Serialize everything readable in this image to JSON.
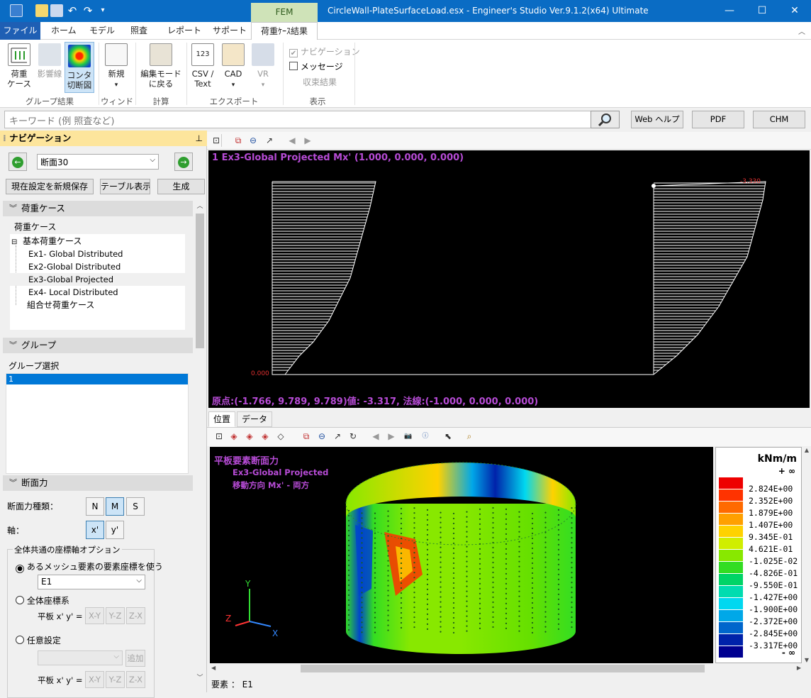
{
  "window": {
    "title": "CircleWall-PlateSurfaceLoad.esx - Engineer's Studio Ver.9.1.2(x64) Ultimate",
    "context_tab": "FEM",
    "controls": [
      "—",
      "☐",
      "✕"
    ]
  },
  "ribbon_tabs": [
    "ファイル",
    "ホーム",
    "モデル",
    "照査",
    "レポート",
    "サポート",
    "荷重ｹｰｽ結果"
  ],
  "ribbon": {
    "groups": [
      {
        "label": "グループ結果",
        "buttons": [
          "荷重\nケース",
          "影響線",
          "コンタ\n切断図"
        ]
      },
      {
        "label": "ウィンドウ",
        "buttons": [
          "新規"
        ]
      },
      {
        "label": "計算",
        "buttons": [
          "編集モード\nに戻る"
        ]
      },
      {
        "label": "エクスポート",
        "buttons": [
          "CSV /\nText",
          "CAD",
          "VR"
        ]
      },
      {
        "label": "表示",
        "checks": [
          "ナビゲーション",
          "メッセージ"
        ],
        "disabled_item": "収束結果"
      }
    ]
  },
  "search": {
    "placeholder": "キーワード (例 照査など)",
    "web_help": "Web ヘルプ",
    "pdf": "PDF",
    "chm": "CHM"
  },
  "nav": {
    "title": "ナビゲーション",
    "section_select": "断面30",
    "save_btn": "現在設定を新規保存",
    "table_btn": "テーブル表示",
    "generate_btn": "生成",
    "load_case": {
      "header": "荷重ケース",
      "root": "荷重ケース",
      "basic": "基本荷重ケース",
      "items": [
        "Ex1- Global Distributed",
        "Ex2-Global Distributed",
        "Ex3-Global Projected",
        "Ex4- Local Distributed"
      ],
      "combo": "組合せ荷重ケース"
    },
    "group": {
      "header": "グループ",
      "label": "グループ選択",
      "selected": "1"
    },
    "section_force": {
      "header": "断面力",
      "type_label": "断面力種類：",
      "types": [
        "N",
        "M",
        "S"
      ],
      "axis_label": "軸：",
      "axes": [
        "x'",
        "y'"
      ],
      "coord_group": "全体共通の座標軸オプション",
      "opt1": "あるメッシュ要素の要素座標を使う",
      "opt1_value": "E1",
      "opt2": "全体座標系",
      "plate_label": "平板 x' y' =",
      "planes": [
        "X-Y",
        "Y-Z",
        "Z-X"
      ],
      "opt3": "任意設定",
      "add_btn": "追加"
    }
  },
  "top_view": {
    "header": "1 Ex3-Global Projected Mx'  (1.000, 0.000, 0.000)",
    "footer": "原点:(-1.766, 9.789, 9.789)値: -3.317, 法線:(-1.000, 0.000, 0.000)",
    "max_label": "-3.330",
    "min_label": "0.000"
  },
  "lower_tabs": [
    "位置",
    "データ"
  ],
  "view3d": {
    "title": "平板要素断面力",
    "subtitle1": "Ex3-Global Projected",
    "subtitle2": "移動方向 Mx' - 両方",
    "axes": [
      "Y",
      "Z",
      "X"
    ]
  },
  "legend": {
    "unit": "kNm/m",
    "top": "+ ∞",
    "bottom": "- ∞",
    "values": [
      "2.824E+00",
      "2.352E+00",
      "1.879E+00",
      "1.407E+00",
      "9.345E-01",
      "4.621E-01",
      "-1.025E-02",
      "-4.826E-01",
      "-9.550E-01",
      "-1.427E+00",
      "-1.900E+00",
      "-2.372E+00",
      "-2.845E+00",
      "-3.317E+00"
    ],
    "colors": [
      "#ee0000",
      "#ff3300",
      "#ff6a00",
      "#ffa000",
      "#ffd200",
      "#d0ee00",
      "#88e800",
      "#33dd22",
      "#00d466",
      "#00dcb0",
      "#00d8f0",
      "#00a8e8",
      "#0066cc",
      "#0022aa",
      "#000090"
    ]
  },
  "status": "要素 ： E1"
}
